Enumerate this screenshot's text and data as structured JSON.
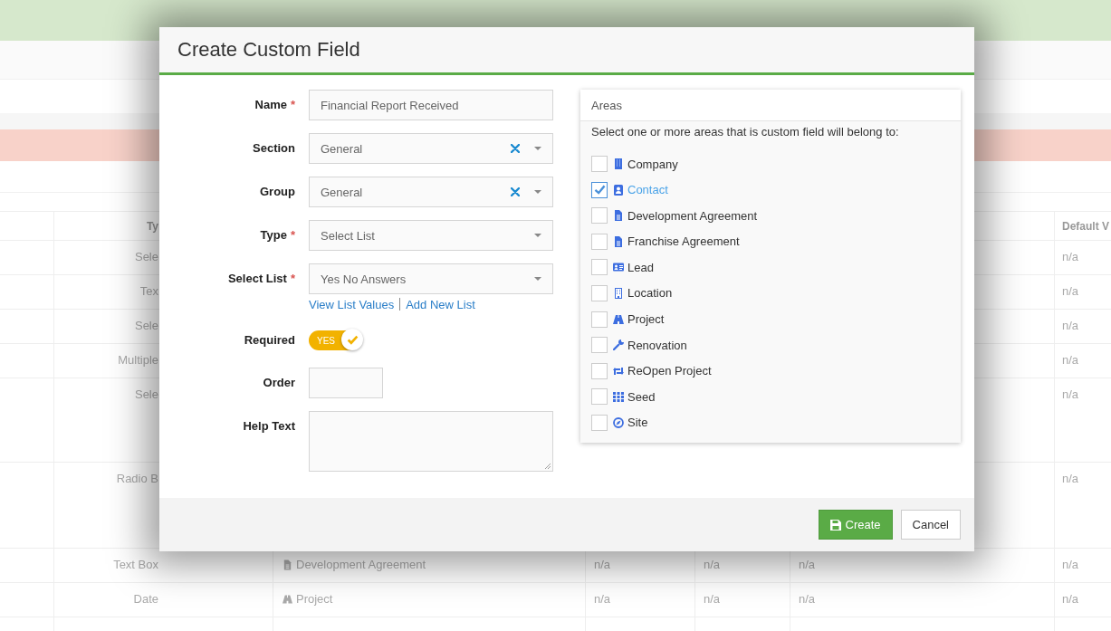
{
  "background_table": {
    "header": {
      "type": "Ty",
      "default": "Default V"
    },
    "rows": [
      {
        "type": "Sele",
        "default": "n/a"
      },
      {
        "type": "Tex",
        "default": "n/a"
      },
      {
        "type": "Sele",
        "default": "n/a"
      },
      {
        "type": "Multiple",
        "default": "n/a"
      },
      {
        "type": "Sele",
        "default": "n/a"
      },
      {
        "type": "Radio B",
        "default": "n/a"
      },
      {
        "type": "Text Box",
        "area": "Development Agreement",
        "column_4": "n/a",
        "column_5": "n/a",
        "column_6": "n/a",
        "default": "n/a"
      },
      {
        "type": "Date",
        "area": "Project",
        "column_4": "n/a",
        "column_5": "n/a",
        "column_6": "n/a",
        "default": "n/a"
      }
    ]
  },
  "modal": {
    "title": "Create Custom Field",
    "fields": [
      {
        "label": "Name",
        "required_mark": "*",
        "kind": "text",
        "value": "Financial Report Received"
      },
      {
        "label": "Section",
        "kind": "select",
        "value": "General",
        "clearable": true
      },
      {
        "label": "Group",
        "kind": "select",
        "value": "General",
        "clearable": true
      },
      {
        "label": "Type",
        "required_mark": "*",
        "kind": "select",
        "value": "Select List",
        "clearable": false
      },
      {
        "label": "Select List",
        "required_mark": "*",
        "kind": "select",
        "value": "Yes No Answers",
        "clearable": false,
        "links": [
          "View List Values",
          "Add New List"
        ]
      },
      {
        "label": "Required",
        "kind": "toggle",
        "on": true,
        "text": "YES"
      },
      {
        "label": "Order",
        "kind": "short"
      },
      {
        "label": "Help Text",
        "kind": "textarea"
      }
    ],
    "areas": {
      "title": "Areas",
      "hint": "Select one or more areas that is custom field will belong to:",
      "items": [
        {
          "label": "Company",
          "checked": false
        },
        {
          "label": "Contact",
          "checked": true
        },
        {
          "label": "Development Agreement",
          "checked": false
        },
        {
          "label": "Franchise Agreement",
          "checked": false
        },
        {
          "label": "Lead",
          "checked": false
        },
        {
          "label": "Location",
          "checked": false
        },
        {
          "label": "Project",
          "checked": false
        },
        {
          "label": "Renovation",
          "checked": false
        },
        {
          "label": "ReOpen Project",
          "checked": false
        },
        {
          "label": "Seed",
          "checked": false
        },
        {
          "label": "Site",
          "checked": false
        }
      ]
    },
    "buttons": {
      "create": "Create",
      "cancel": "Cancel"
    }
  }
}
